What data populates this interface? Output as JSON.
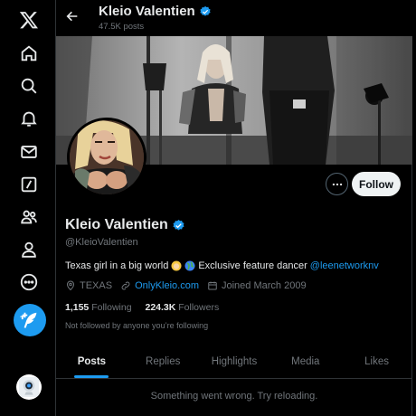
{
  "nav": {
    "icons": [
      "x-logo-icon",
      "home-icon",
      "search-icon",
      "notifications-icon",
      "messages-icon",
      "grok-icon",
      "communities-icon",
      "profile-icon",
      "more-icon"
    ],
    "post_button": "post-button"
  },
  "header": {
    "name": "Kleio Valentien",
    "posts_count": "47.5K posts"
  },
  "profile": {
    "name": "Kleio Valentien",
    "handle": "@KleioValentien",
    "verified": true,
    "follow_label": "Follow",
    "bio_text_1": "Texas girl in a big world",
    "bio_text_2": "Exclusive feature dancer",
    "bio_mention": "@leenetworknv",
    "location": "TEXAS",
    "website": "OnlyKleio.com",
    "joined": "Joined March 2009",
    "following_count": "1,155",
    "following_label": "Following",
    "followers_count": "224.3K",
    "followers_label": "Followers",
    "not_followed_text": "Not followed by anyone you’re following"
  },
  "tabs": [
    {
      "label": "Posts",
      "active": true
    },
    {
      "label": "Replies",
      "active": false
    },
    {
      "label": "Highlights",
      "active": false
    },
    {
      "label": "Media",
      "active": false
    },
    {
      "label": "Likes",
      "active": false
    }
  ],
  "feed": {
    "error_text": "Something went wrong. Try reloading."
  },
  "colors": {
    "accent": "#1d9bf0",
    "background": "#000000",
    "text": "#e7e9ea",
    "muted": "#71767b",
    "border": "#2f3336"
  }
}
